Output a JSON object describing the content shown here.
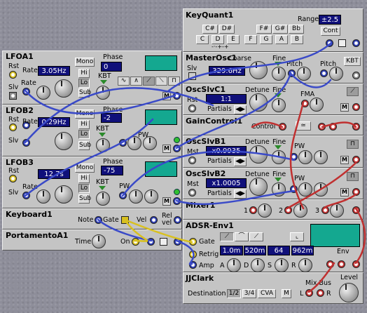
{
  "lfoa1": {
    "title": "LFOA1",
    "rst": "Rst",
    "slv": "Slv",
    "rate_label": "Rate",
    "rate_value": "3.05Hz",
    "mono": "Mono",
    "phase_label": "Phase",
    "phase_value": "0",
    "hi": "Hi",
    "lo": "Lo",
    "sub": "Sub",
    "kbt": "KBT",
    "m": "M"
  },
  "lfob2": {
    "title": "LFOB2",
    "rst": "Rst",
    "slv": "Slv",
    "rate_label": "Rate",
    "rate_value": "0.29Hz",
    "mono": "Mono",
    "phase_label": "Phase",
    "phase_value": "-2",
    "hi": "Hi",
    "lo": "Lo",
    "sub": "Sub",
    "kbt": "KBT",
    "pw": "PW",
    "m": "M"
  },
  "lfob3": {
    "title": "LFOB3",
    "rst": "Rst",
    "slv": "Slv",
    "rate_label": "Rate",
    "rate_value": "12.7s",
    "mono": "Mono",
    "phase_label": "Phase",
    "phase_value": "-75",
    "hi": "Hi",
    "lo": "Lo",
    "sub": "Sub",
    "kbt": "KBT",
    "pw": "PW",
    "m": "M"
  },
  "keyboard1": {
    "title": "Keyboard1",
    "note": "Note",
    "gate": "Gate",
    "vel": "Vel",
    "rel": "Rel",
    "relvel": "vel"
  },
  "portamento": {
    "title": "PortamentoA1",
    "time": "Time",
    "on": "On"
  },
  "keyquant": {
    "title": "KeyQuant1",
    "range_label": "Range",
    "range_value": "±2.5",
    "cont": "Cont",
    "keys_top": [
      "C#",
      "D#",
      "F#",
      "G#",
      "Bb"
    ],
    "keys_bottom": [
      "C",
      "D",
      "E",
      "F",
      "G",
      "A",
      "B"
    ],
    "arrows": "-·-+-+"
  },
  "masterosc": {
    "title": "MasterOsc1",
    "slv": "Slv",
    "coarse": "Coarse",
    "fine": "Fine",
    "value": "329.6Hz",
    "pitch1": "Pitch",
    "pitch2": "Pitch",
    "kbt": "KBT"
  },
  "oscslvc1": {
    "title": "OscSlvC1",
    "rst": "Rst",
    "detune": "Detune",
    "fine": "Fine",
    "value": "1:1",
    "partials": "Partials",
    "fma": "FMA",
    "m": "M"
  },
  "gaincontrol": {
    "title": "GainControl1",
    "control": "Control"
  },
  "oscslvb1": {
    "title": "OscSlvB1",
    "mst": "Mst",
    "detune": "Detune",
    "fine": "Fine",
    "value": "x0.9935",
    "partials": "Partials",
    "pw": "PW",
    "m": "M"
  },
  "oscslvb2": {
    "title": "OscSlvB2",
    "mst": "Mst",
    "detune": "Detune",
    "fine": "Fine",
    "value": "x1.0005",
    "partials": "Partials",
    "pw": "PW",
    "m": "M"
  },
  "mixer1": {
    "title": "Mixer1",
    "in1": "1",
    "in2": "2",
    "in3": "3"
  },
  "adsr": {
    "title": "ADSR-Env1",
    "gate": "Gate",
    "retrig": "Retrig",
    "amp": "Amp",
    "a": "A",
    "d": "D",
    "s": "S",
    "r": "R",
    "env": "Env",
    "vals": [
      "1.0m",
      "520m",
      "64",
      "962m"
    ]
  },
  "jjclark": {
    "title": "JJClark",
    "destination": "Destination",
    "d1": "1/2",
    "d2": "3/4",
    "d3": "CVA",
    "m": "M",
    "mixbus": "Mix Bus",
    "level": "Level",
    "l": "L",
    "r": "R"
  }
}
